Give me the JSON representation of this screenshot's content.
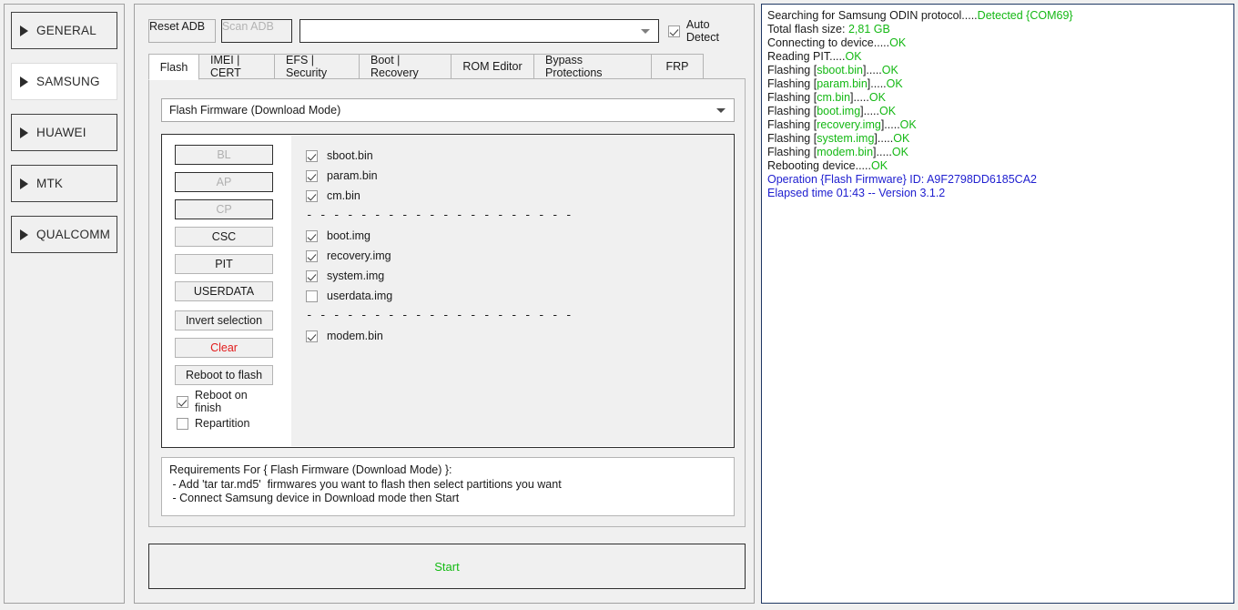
{
  "sidebar": {
    "items": [
      {
        "label": "GENERAL",
        "icon": "triangle-right-icon",
        "active": false
      },
      {
        "label": "SAMSUNG",
        "icon": "triangle-right-icon",
        "active": true
      },
      {
        "label": "HUAWEI",
        "icon": "triangle-right-icon",
        "active": false
      },
      {
        "label": "MTK",
        "icon": "triangle-right-icon",
        "active": false
      },
      {
        "label": "QUALCOMM",
        "icon": "triangle-right-icon",
        "active": false
      }
    ]
  },
  "toolbar": {
    "reset_adb_label": "Reset ADB",
    "scan_adb_label": "Scan ADB",
    "device_combo_value": "",
    "device_combo_placeholder": "",
    "auto_detect_label": "Auto Detect",
    "auto_detect_checked": true
  },
  "tabs": [
    {
      "label": "Flash",
      "active": true
    },
    {
      "label": "IMEI | CERT",
      "active": false
    },
    {
      "label": "EFS | Security",
      "active": false
    },
    {
      "label": "Boot | Recovery",
      "active": false
    },
    {
      "label": "ROM Editor",
      "active": false
    },
    {
      "label": "Bypass Protections",
      "active": false
    },
    {
      "label": "FRP",
      "active": false
    }
  ],
  "flash": {
    "operation_combo_value": "Flash Firmware (Download Mode)",
    "partition_buttons": [
      {
        "label": "BL",
        "disabled": true
      },
      {
        "label": "AP",
        "disabled": true
      },
      {
        "label": "CP",
        "disabled": true
      },
      {
        "label": "CSC",
        "disabled": false
      },
      {
        "label": "PIT",
        "disabled": false
      },
      {
        "label": "USERDATA",
        "disabled": false
      }
    ],
    "action_buttons": [
      {
        "label": "Invert selection",
        "style": "normal"
      },
      {
        "label": "Clear",
        "style": "danger"
      },
      {
        "label": "Reboot to flash",
        "style": "normal"
      }
    ],
    "options": [
      {
        "label": "Reboot on finish",
        "checked": true
      },
      {
        "label": "Repartition",
        "checked": false
      }
    ],
    "file_groups": [
      {
        "files": [
          {
            "label": "sboot.bin",
            "checked": true
          },
          {
            "label": "param.bin",
            "checked": true
          },
          {
            "label": "cm.bin",
            "checked": true
          }
        ]
      },
      {
        "files": [
          {
            "label": "boot.img",
            "checked": true
          },
          {
            "label": "recovery.img",
            "checked": true
          },
          {
            "label": "system.img",
            "checked": true
          },
          {
            "label": "userdata.img",
            "checked": false
          }
        ]
      },
      {
        "files": [
          {
            "label": "modem.bin",
            "checked": true
          }
        ]
      }
    ],
    "separator_text": "- - - - - - - - - - - - - - - - - - - -",
    "requirements": "Requirements For { Flash Firmware (Download Mode) }:\n - Add 'tar tar.md5'  firmwares you want to flash then select partitions you want\n - Connect Samsung device in Download mode then Start",
    "start_label": "Start",
    "start_color": "#13bb13"
  },
  "log": {
    "lines": [
      [
        {
          "t": "Searching for Samsung ODIN protocol.....",
          "c": "black"
        },
        {
          "t": "Detected {COM69}",
          "c": "green"
        }
      ],
      [
        {
          "t": "Total flash size: ",
          "c": "black"
        },
        {
          "t": "2,81 GB",
          "c": "green"
        }
      ],
      [
        {
          "t": "Connecting to device.....",
          "c": "black"
        },
        {
          "t": "OK",
          "c": "green"
        }
      ],
      [
        {
          "t": "Reading PIT.....",
          "c": "black"
        },
        {
          "t": "OK",
          "c": "green"
        }
      ],
      [
        {
          "t": "Flashing [",
          "c": "black"
        },
        {
          "t": "sboot.bin",
          "c": "green"
        },
        {
          "t": "].....",
          "c": "black"
        },
        {
          "t": "OK",
          "c": "green"
        }
      ],
      [
        {
          "t": "Flashing [",
          "c": "black"
        },
        {
          "t": "param.bin",
          "c": "green"
        },
        {
          "t": "].....",
          "c": "black"
        },
        {
          "t": "OK",
          "c": "green"
        }
      ],
      [
        {
          "t": "Flashing [",
          "c": "black"
        },
        {
          "t": "cm.bin",
          "c": "green"
        },
        {
          "t": "].....",
          "c": "black"
        },
        {
          "t": "OK",
          "c": "green"
        }
      ],
      [
        {
          "t": "Flashing [",
          "c": "black"
        },
        {
          "t": "boot.img",
          "c": "green"
        },
        {
          "t": "].....",
          "c": "black"
        },
        {
          "t": "OK",
          "c": "green"
        }
      ],
      [
        {
          "t": "Flashing [",
          "c": "black"
        },
        {
          "t": "recovery.img",
          "c": "green"
        },
        {
          "t": "].....",
          "c": "black"
        },
        {
          "t": "OK",
          "c": "green"
        }
      ],
      [
        {
          "t": "Flashing [",
          "c": "black"
        },
        {
          "t": "system.img",
          "c": "green"
        },
        {
          "t": "].....",
          "c": "black"
        },
        {
          "t": "OK",
          "c": "green"
        }
      ],
      [
        {
          "t": "Flashing [",
          "c": "black"
        },
        {
          "t": "modem.bin",
          "c": "green"
        },
        {
          "t": "].....",
          "c": "black"
        },
        {
          "t": "OK",
          "c": "green"
        }
      ],
      [
        {
          "t": "Rebooting device.....",
          "c": "black"
        },
        {
          "t": "OK",
          "c": "green"
        }
      ],
      [
        {
          "t": "Operation {Flash Firmware} ID: A9F2798DD6185CA2",
          "c": "blue"
        }
      ],
      [
        {
          "t": "Elapsed time 01:43 -- Version 3.1.2",
          "c": "blue"
        }
      ]
    ]
  },
  "colors": {
    "green": "#14b814",
    "blue": "#2020d0",
    "danger": "#e21b1b",
    "panel_bg": "#f0f0f0",
    "log_border": "#1f3864"
  }
}
